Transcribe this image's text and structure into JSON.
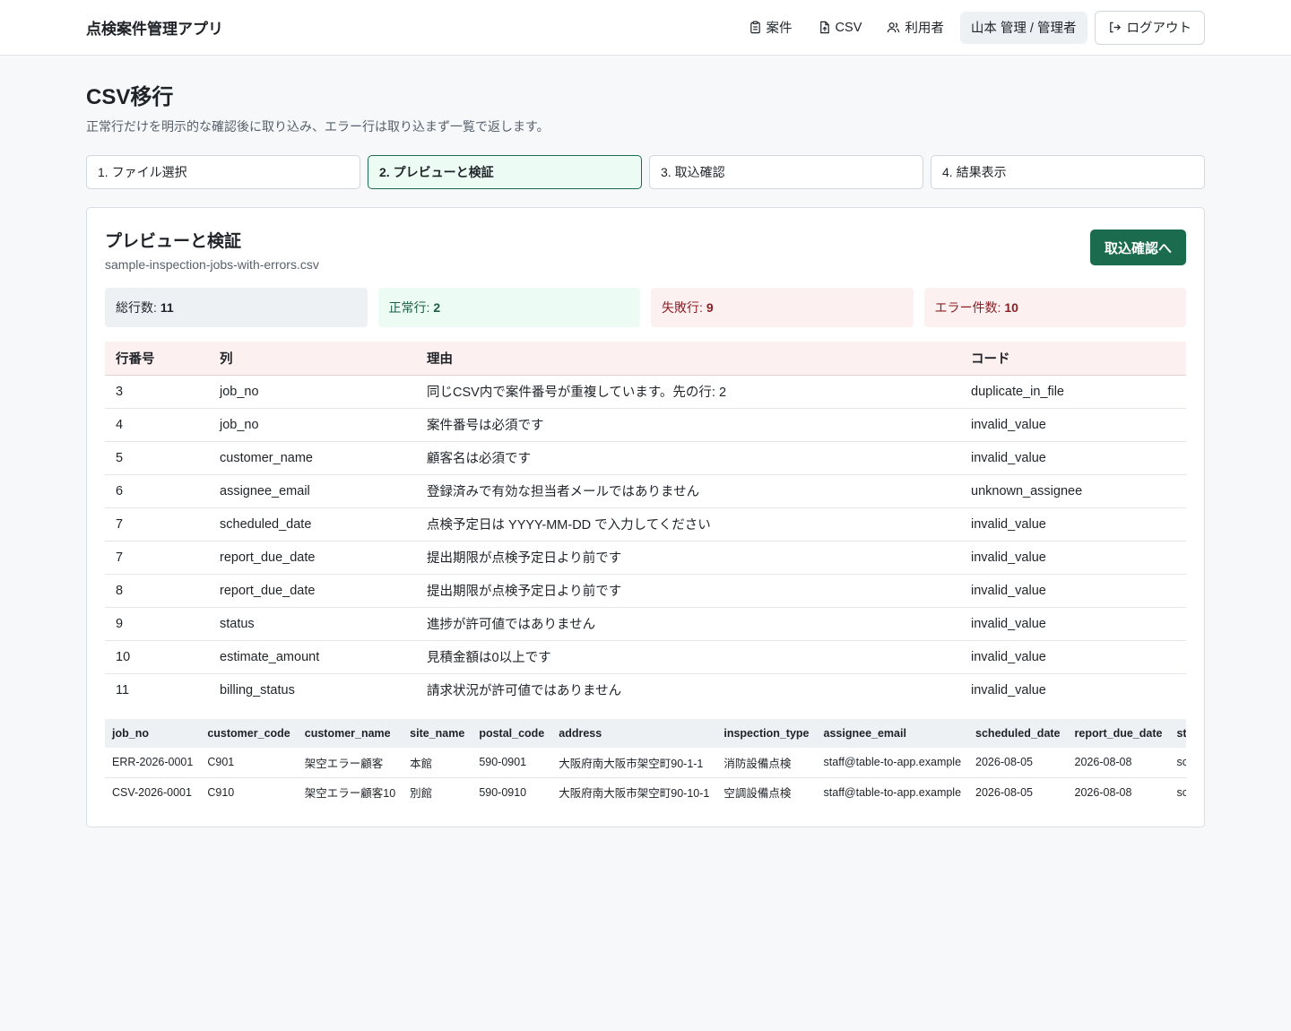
{
  "app": {
    "title": "点検案件管理アプリ"
  },
  "nav": {
    "items": [
      {
        "label": "案件",
        "icon": "clipboard-icon"
      },
      {
        "label": "CSV",
        "icon": "file-upload-icon"
      },
      {
        "label": "利用者",
        "icon": "users-icon"
      }
    ],
    "user": "山本 管理 / 管理者",
    "logout": "ログアウト"
  },
  "page": {
    "title": "CSV移行",
    "subtitle": "正常行だけを明示的な確認後に取り込み、エラー行は取り込まず一覧で返します。"
  },
  "steps": [
    {
      "label": "1. ファイル選択",
      "active": false
    },
    {
      "label": "2. プレビューと検証",
      "active": true
    },
    {
      "label": "3. 取込確認",
      "active": false
    },
    {
      "label": "4. 結果表示",
      "active": false
    }
  ],
  "card": {
    "title": "プレビューと検証",
    "filename": "sample-inspection-jobs-with-errors.csv",
    "confirm_button": "取込確認へ"
  },
  "stats": {
    "total_label": "総行数:",
    "total": "11",
    "ok_label": "正常行:",
    "ok": "2",
    "fail_label": "失敗行:",
    "fail": "9",
    "err_label": "エラー件数:",
    "err": "10"
  },
  "errors": {
    "headers": [
      "行番号",
      "列",
      "理由",
      "コード"
    ],
    "rows": [
      [
        "3",
        "job_no",
        "同じCSV内で案件番号が重複しています。先の行: 2",
        "duplicate_in_file"
      ],
      [
        "4",
        "job_no",
        "案件番号は必須です",
        "invalid_value"
      ],
      [
        "5",
        "customer_name",
        "顧客名は必須です",
        "invalid_value"
      ],
      [
        "6",
        "assignee_email",
        "登録済みで有効な担当者メールではありません",
        "unknown_assignee"
      ],
      [
        "7",
        "scheduled_date",
        "点検予定日は YYYY-MM-DD で入力してください",
        "invalid_value"
      ],
      [
        "7",
        "report_due_date",
        "提出期限が点検予定日より前です",
        "invalid_value"
      ],
      [
        "8",
        "report_due_date",
        "提出期限が点検予定日より前です",
        "invalid_value"
      ],
      [
        "9",
        "status",
        "進捗が許可値ではありません",
        "invalid_value"
      ],
      [
        "10",
        "estimate_amount",
        "見積金額は0以上です",
        "invalid_value"
      ],
      [
        "11",
        "billing_status",
        "請求状況が許可値ではありません",
        "invalid_value"
      ]
    ]
  },
  "preview": {
    "headers": [
      "job_no",
      "customer_code",
      "customer_name",
      "site_name",
      "postal_code",
      "address",
      "inspection_type",
      "assignee_email",
      "scheduled_date",
      "report_due_date",
      "status"
    ],
    "rows": [
      [
        "ERR-2026-0001",
        "C901",
        "架空エラー顧客",
        "本館",
        "590-0901",
        "大阪府南大阪市架空町90-1-1",
        "消防設備点検",
        "staff@table-to-app.example",
        "2026-08-05",
        "2026-08-08",
        "scheduled"
      ],
      [
        "CSV-2026-0001",
        "C910",
        "架空エラー顧客10",
        "別館",
        "590-0910",
        "大阪府南大阪市架空町90-10-1",
        "空調設備点検",
        "staff@table-to-app.example",
        "2026-08-05",
        "2026-08-08",
        "scheduled"
      ]
    ]
  }
}
